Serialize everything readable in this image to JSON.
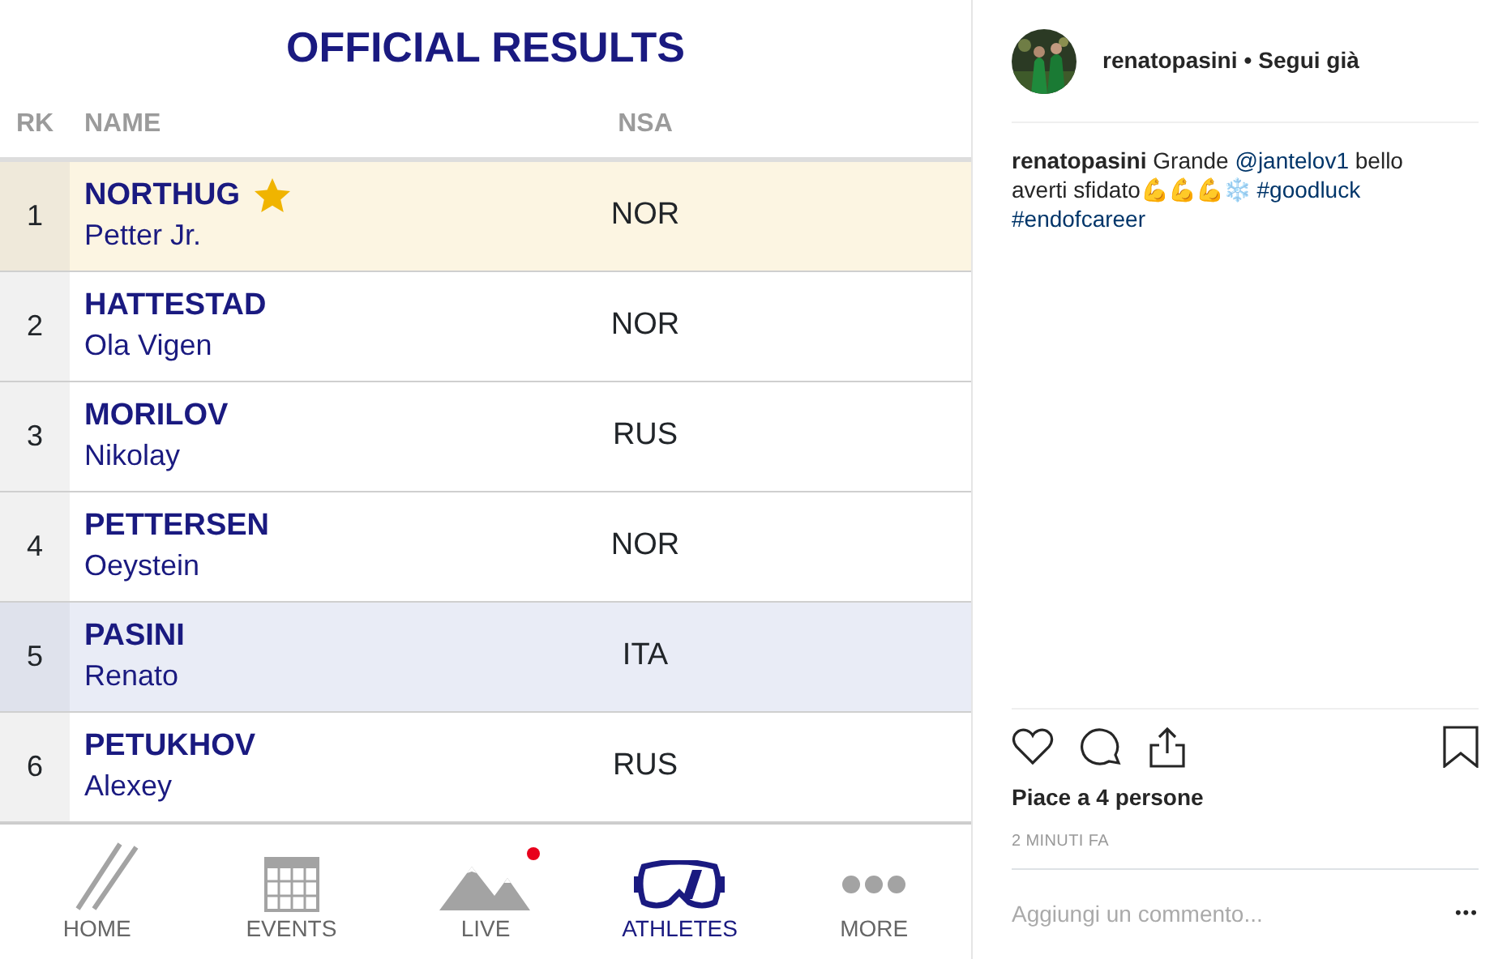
{
  "results": {
    "title": "OFFICIAL RESULTS",
    "columns": [
      "RK",
      "NAME",
      "NSA"
    ],
    "rows": [
      {
        "rank": "1",
        "surname": "NORTHUG",
        "given": "Petter Jr.",
        "nsa": "NOR",
        "starred": true,
        "selected": false
      },
      {
        "rank": "2",
        "surname": "HATTESTAD",
        "given": "Ola Vigen",
        "nsa": "NOR",
        "starred": false,
        "selected": false
      },
      {
        "rank": "3",
        "surname": "MORILOV",
        "given": "Nikolay",
        "nsa": "RUS",
        "starred": false,
        "selected": false
      },
      {
        "rank": "4",
        "surname": "PETTERSEN",
        "given": "Oeystein",
        "nsa": "NOR",
        "starred": false,
        "selected": false
      },
      {
        "rank": "5",
        "surname": "PASINI",
        "given": "Renato",
        "nsa": "ITA",
        "starred": false,
        "selected": true
      },
      {
        "rank": "6",
        "surname": "PETUKHOV",
        "given": "Alexey",
        "nsa": "RUS",
        "starred": false,
        "selected": false
      }
    ],
    "tabs": [
      {
        "label": "HOME",
        "kind": "logo",
        "selected": false,
        "notification": false
      },
      {
        "label": "EVENTS",
        "kind": "calendar",
        "selected": false,
        "notification": false
      },
      {
        "label": "LIVE",
        "kind": "mountains",
        "selected": false,
        "notification": true
      },
      {
        "label": "ATHLETES",
        "kind": "goggles",
        "selected": true,
        "notification": false
      },
      {
        "label": "MORE",
        "kind": "dots",
        "selected": false,
        "notification": false
      }
    ]
  },
  "post": {
    "username": "renatopasini",
    "separator": "•",
    "follow": "Segui già",
    "caption": {
      "username": "renatopasini",
      "parts": [
        {
          "kind": "plain",
          "text": "Grande "
        },
        {
          "kind": "link",
          "text": "@jantelov1"
        },
        {
          "kind": "plain",
          "text": " bello averti sfidato💪💪💪❄️ "
        },
        {
          "kind": "link",
          "text": "#goodluck"
        },
        {
          "kind": "link",
          "text": "#endofcareer"
        }
      ]
    },
    "likes": "Piace a 4 persone",
    "time": "2 MINUTI FA",
    "comment_placeholder": "Aggiungi un commento...",
    "more": "•••"
  }
}
